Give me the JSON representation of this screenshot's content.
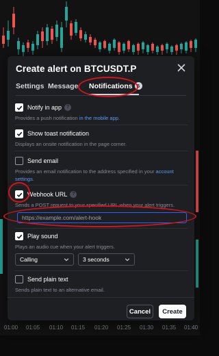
{
  "chart": {
    "time_labels": [
      "01:00",
      "01:05",
      "01:10",
      "01:15",
      "01:20",
      "01:25",
      "01:30",
      "01:35",
      "01:40"
    ]
  },
  "dialog": {
    "title": "Create alert on BTCUSDT.P",
    "tabs": [
      {
        "label": "Settings"
      },
      {
        "label": "Message"
      },
      {
        "label": "Notifications",
        "count": "5"
      }
    ],
    "options": {
      "notify_in_app": {
        "label": "Notify in app",
        "checked": true,
        "desc_prefix": "Provides a push notification ",
        "desc_link": "in the mobile app",
        "desc_suffix": "."
      },
      "show_toast": {
        "label": "Show toast notification",
        "checked": true,
        "desc": "Displays an onsite notification in the page corner."
      },
      "send_email": {
        "label": "Send email",
        "checked": false,
        "desc_prefix": "Provides an email notification to the address specified in your ",
        "desc_link": "account settings",
        "desc_suffix": "."
      },
      "webhook": {
        "label": "Webhook URL",
        "checked": true,
        "desc": "Sends a POST request to your specified URL when your alert triggers.",
        "placeholder": "https://example.com/alert-hook"
      },
      "play_sound": {
        "label": "Play sound",
        "checked": true,
        "desc": "Plays an audio cue when your alert triggers.",
        "sound": "Calling",
        "duration": "3 seconds"
      },
      "plain_text": {
        "label": "Send plain text",
        "checked": false,
        "desc": "Sends plain text to an alternative email."
      }
    },
    "buttons": {
      "cancel": "Cancel",
      "create": "Create"
    }
  },
  "colors": {
    "annotation": "#d3141c",
    "bull": "#26a69a",
    "bear": "#ef5350",
    "link": "#5b9cf6",
    "focus": "#2962ff"
  }
}
